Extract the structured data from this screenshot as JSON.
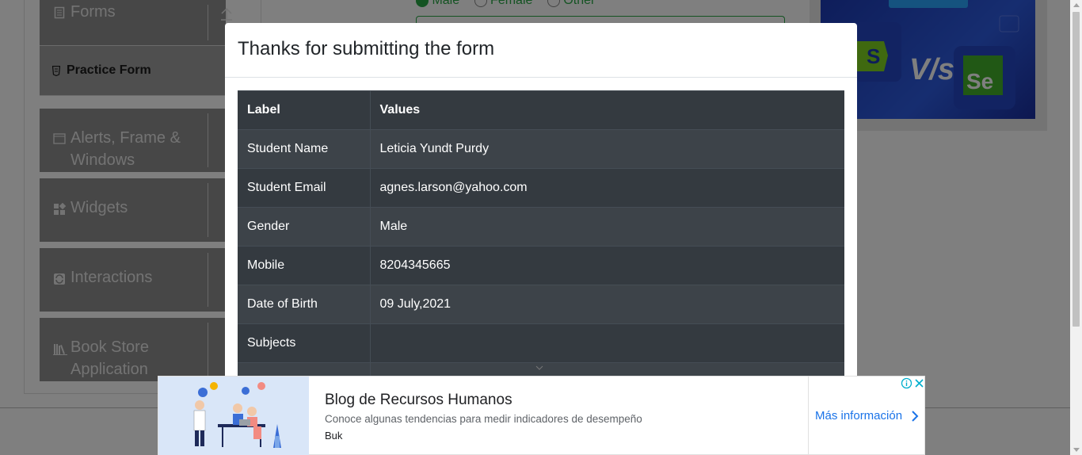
{
  "sidebar": {
    "groups": [
      {
        "label": "Forms",
        "icon": "form-icon"
      },
      {
        "label": "Alerts, Frame & Windows",
        "line1": "Alerts, Frame &",
        "line2": "Windows",
        "icon": "window-icon"
      },
      {
        "label": "Widgets",
        "icon": "widgets-icon"
      },
      {
        "label": "Interactions",
        "icon": "interactions-icon"
      },
      {
        "label": "Book Store Application",
        "line1": "Book Store",
        "line2": "Application",
        "icon": "books-icon"
      }
    ],
    "active_item": "Practice Form"
  },
  "form_bg": {
    "gender_options": [
      "Male",
      "Female",
      "Other"
    ]
  },
  "modal": {
    "title": "Thanks for submitting the form",
    "table": {
      "headers": [
        "Label",
        "Values"
      ],
      "rows": [
        {
          "label": "Student Name",
          "value": "Leticia Yundt Purdy"
        },
        {
          "label": "Student Email",
          "value": "agnes.larson@yahoo.com"
        },
        {
          "label": "Gender",
          "value": "Male"
        },
        {
          "label": "Mobile",
          "value": "8204345665"
        },
        {
          "label": "Date of Birth",
          "value": "09 July,2021"
        },
        {
          "label": "Subjects",
          "value": ""
        }
      ]
    }
  },
  "ad_bottom": {
    "title": "Blog de Recursos Humanos",
    "description": "Conoce algunas tendencias para medir indicadores de desempeño",
    "brand": "Buk",
    "cta": "Más información"
  },
  "colors": {
    "table_bg": "#343a40",
    "table_row_alt": "#3d4349",
    "sidebar_bg": "#8f8f8f",
    "link_blue": "#1a73e8",
    "radio_green": "#28a745"
  }
}
